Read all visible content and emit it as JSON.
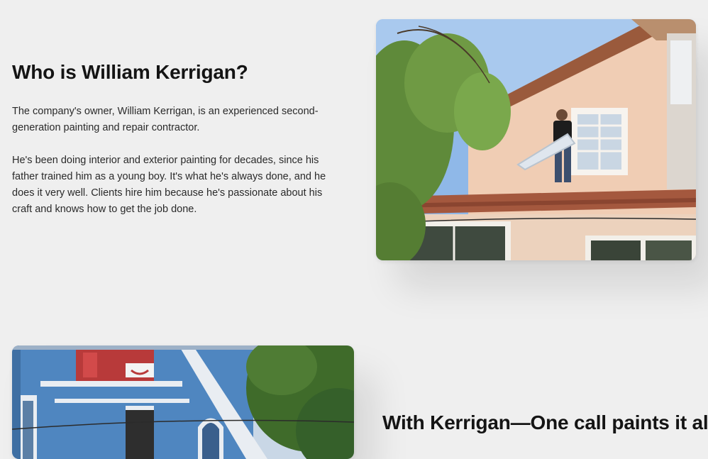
{
  "about": {
    "heading": "Who is William Kerrigan?",
    "paragraph_1": "The company's owner, William Kerrigan, is an experienced second-generation painting and repair contractor.",
    "paragraph_2": "He's been doing interior and exterior painting for decades, since his father trained him as a young boy. It's what he's always done, and he does it very well. Clients hire him because he's passionate about his craft and knows how to get the job done."
  },
  "tagline": {
    "text": "With Kerrigan—One call paints it all."
  },
  "images": {
    "top_alt": "Worker on roof carrying a window panel beside a peach stucco house",
    "bottom_alt": "Blue Victorian house with red and white trim and a tree"
  }
}
